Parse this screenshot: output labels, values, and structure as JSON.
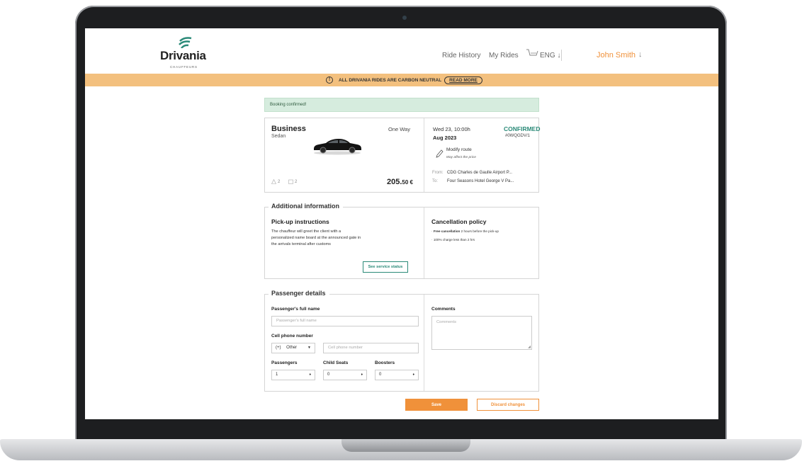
{
  "app": {
    "logo": {
      "name": "Drivania",
      "sub": "CHAUFFEURS"
    },
    "nav": {
      "ride_history": "Ride History",
      "my_rides": "My Rides",
      "language": "ENG ↓",
      "user": "John Smith",
      "user_arrow": "↓"
    }
  },
  "banner": {
    "icon": "!",
    "text": "ALL DRIVANIA RIDES ARE CARBON NEUTRAL",
    "button": "READ MORE"
  },
  "alert": {
    "text": "Booking confirmed!"
  },
  "booking": {
    "class": "Business",
    "type": "Sedan",
    "trip": "One Way",
    "passengers_capacity": "2",
    "luggage_capacity": "2",
    "price": "205.",
    "price_cents": "50 €",
    "date": "Wed 23, 10:00h",
    "month_year": "Aug 2023",
    "status": "CONFIRMED",
    "reference": "#0WQGDV/1",
    "modify_label": "Modify route",
    "modify_note": "May affect the price",
    "from_label": "From:",
    "from_value": "CDG Charles de Gaulle Airport P...",
    "to_label": "To:",
    "to_value": "Four Seasons Hotel George V Pa..."
  },
  "additional_info": {
    "legend": "Additional information",
    "pickup_title": "Pick-up instructions",
    "pickup_text": "The chauffeur will greet the client with a personalized name board at the announced gate in the arrivals terminal after customs",
    "status_button": "See service status",
    "policy_title": "Cancellation policy",
    "policy_line1_bold": "Free cancellation",
    "policy_line1_rest": " 2 hours before the pick-up",
    "policy_line2": "100% charge less than 2 hrs"
  },
  "passenger": {
    "legend": "Passenger details",
    "name_label": "Passenger's full name",
    "name_placeholder": "Passenger's full name",
    "phone_label": "Cell phone number",
    "phone_prefix": "(+)",
    "phone_country": "Other",
    "phone_placeholder": "Cell phone number",
    "passengers_label": "Passengers",
    "passengers_value": "1",
    "child_seats_label": "Child Seats",
    "child_seats_value": "0",
    "boosters_label": "Boosters",
    "boosters_value": "0",
    "comments_label": "Comments",
    "comments_placeholder": "Comments"
  },
  "actions": {
    "save": "Save",
    "discard": "Discard changes"
  },
  "colors": {
    "accent": "#f0913a",
    "teal": "#2b8a78",
    "banner": "#f3c07e",
    "alert_bg": "#d6ecde"
  }
}
